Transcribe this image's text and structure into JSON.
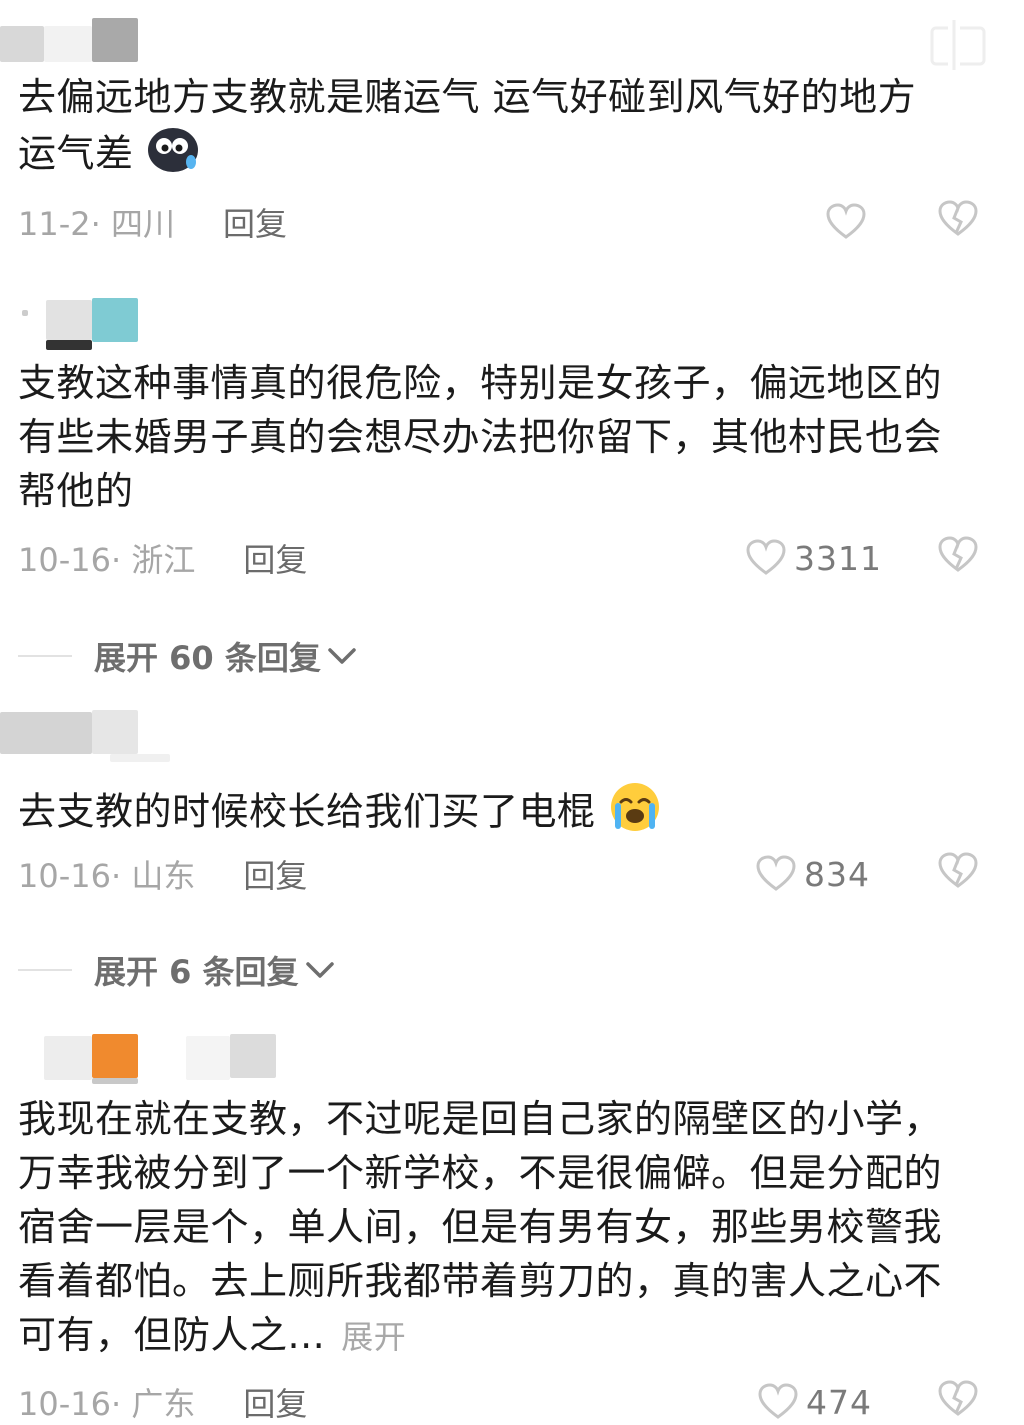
{
  "comments": [
    {
      "text_line1": "去偏远地方支教就是赌运气 运气好碰到风气好的地方",
      "text_line2": "运气差",
      "emoji_icon": "dark-face-sweat-icon",
      "date_loc": "11-2· 四川",
      "reply_label": "回复",
      "likes": ""
    },
    {
      "text": "支教这种事情真的很危险，特别是女孩子，偏远地区的有些未婚男子真的会想尽办法把你留下，其他村民也会帮他的",
      "date_loc": "10-16· 浙江",
      "reply_label": "回复",
      "likes": "3311",
      "expand_label": "展开 60 条回复"
    },
    {
      "text": "去支教的时候校长给我们买了电棍",
      "emoji_icon": "crying-face-icon",
      "date_loc": "10-16· 山东",
      "reply_label": "回复",
      "likes": "834",
      "expand_label": "展开 6 条回复"
    },
    {
      "text": "我现在就在支教，不过呢是回自己家的隔壁区的小学，万幸我被分到了一个新学校，不是很偏僻。但是分配的宿舍一层是个，单人间，但是有男有女，那些男校警我看着都怕。去上厕所我都带着剪刀的，真的害人之心不可有，但防人之...",
      "more_label": "展开",
      "date_loc": "10-16· 广东",
      "reply_label": "回复",
      "likes": "474"
    }
  ],
  "colors": {
    "text": "#1b1b1b",
    "meta": "#a6a6a6",
    "reply": "#6b6b6b",
    "icon": "#c8c8c8"
  }
}
